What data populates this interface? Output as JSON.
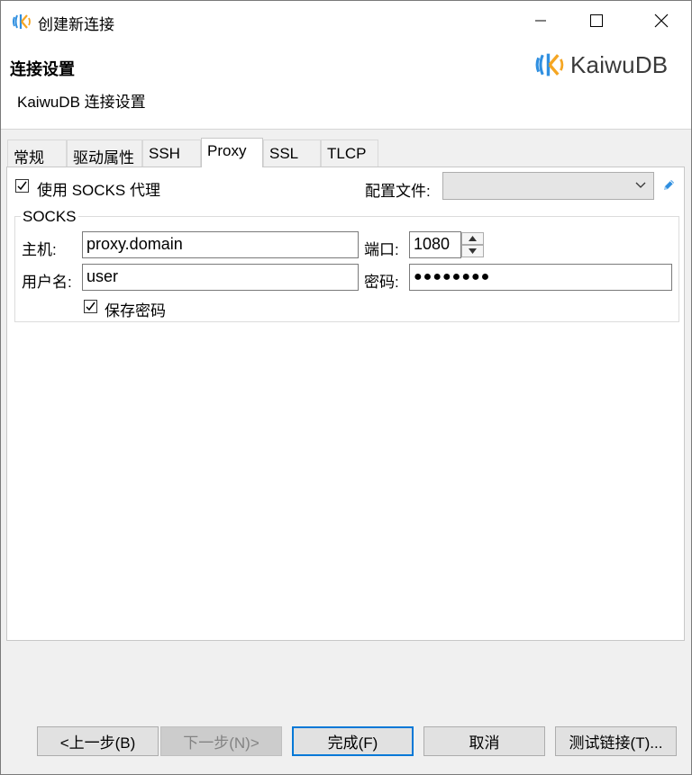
{
  "window": {
    "title": "创建新连接",
    "brand_name": "KaiwuDB"
  },
  "header": {
    "title": "连接设置",
    "subtitle": "KaiwuDB 连接设置"
  },
  "tabs": [
    {
      "label": "常规"
    },
    {
      "label": "驱动属性"
    },
    {
      "label": "SSH"
    },
    {
      "label": "Proxy",
      "active": true
    },
    {
      "label": "SSL"
    },
    {
      "label": "TLCP"
    }
  ],
  "proxy": {
    "use_socks_label": "使用 SOCKS 代理",
    "use_socks_checked": true,
    "profile_label": "配置文件:",
    "profile_value": "",
    "group_title": "SOCKS",
    "host_label": "主机:",
    "host_value": "proxy.domain",
    "port_label": "端口:",
    "port_value": "1080",
    "user_label": "用户名:",
    "user_value": "user",
    "password_label": "密码:",
    "password_value": "●●●●●●●●",
    "save_password_label": "保存密码",
    "save_password_checked": true
  },
  "buttons": {
    "back": "<上一步(B)",
    "next": "下一步(N)>",
    "finish": "完成(F)",
    "cancel": "取消",
    "test": "测试链接(T)..."
  },
  "icons": {
    "app": "kaiwudb-logo-icon",
    "edit": "pencil-icon"
  },
  "colors": {
    "accent": "#0078d7",
    "logo_blue": "#2f8fe0",
    "logo_orange": "#f5a623"
  }
}
